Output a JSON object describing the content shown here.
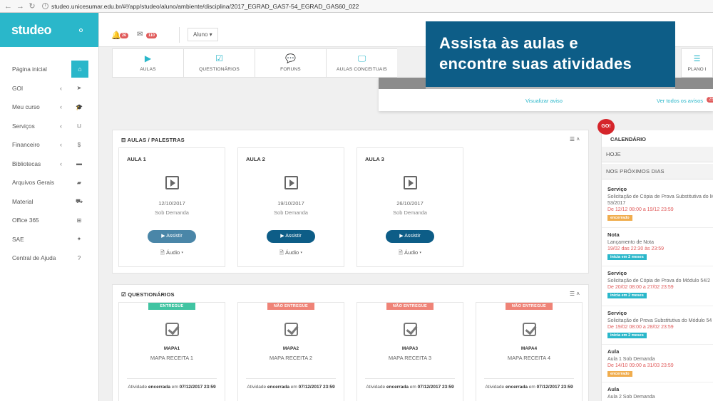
{
  "browser": {
    "url": "studeo.unicesumar.edu.br/#!/app/studeo/aluno/ambiente/disciplina/2017_EGRAD_GAS7-54_EGRAD_GAS60_022"
  },
  "sidebar": {
    "logo": "studeo",
    "items": [
      {
        "label": "Página inicial",
        "icon": "home-icon",
        "glyph": "⌂",
        "chevron": ""
      },
      {
        "label": "GOI",
        "icon": "send-icon",
        "glyph": "➤",
        "chevron": "‹"
      },
      {
        "label": "Meu curso",
        "icon": "graduation-cap-icon",
        "glyph": "🎓",
        "chevron": "‹"
      },
      {
        "label": "Serviços",
        "icon": "basket-icon",
        "glyph": "⊔",
        "chevron": "‹"
      },
      {
        "label": "Financeiro",
        "icon": "dollar-icon",
        "glyph": "$",
        "chevron": "‹"
      },
      {
        "label": "Bibliotecas",
        "icon": "book-icon",
        "glyph": "▬",
        "chevron": "‹"
      },
      {
        "label": "Arquivos Gerais",
        "icon": "folder-icon",
        "glyph": "▰",
        "chevron": ""
      },
      {
        "label": "Material",
        "icon": "truck-icon",
        "glyph": "⛟",
        "chevron": ""
      },
      {
        "label": "Office 365",
        "icon": "windows-icon",
        "glyph": "⊞",
        "chevron": ""
      },
      {
        "label": "SAE",
        "icon": "puzzle-icon",
        "glyph": "✦",
        "chevron": ""
      },
      {
        "label": "Central de Ajuda",
        "icon": "question-icon",
        "glyph": "?",
        "chevron": ""
      }
    ]
  },
  "header": {
    "notifications_count": "26",
    "messages_count": "110",
    "profile_select": "Aluno ▾"
  },
  "tabs": [
    {
      "label": "AULAS",
      "glyph": "▶",
      "icon": "play-square-icon"
    },
    {
      "label": "QUESTIONÁRIOS",
      "glyph": "☑",
      "icon": "checkbox-icon"
    },
    {
      "label": "FORUNS",
      "glyph": "💬",
      "icon": "comments-icon"
    },
    {
      "label": "AULAS CONCEITUAIS",
      "glyph": "🖵",
      "icon": "monitor-icon"
    }
  ],
  "tab_plano": {
    "label": "PLANO I",
    "glyph": "☰",
    "icon": "list-icon"
  },
  "overlay": {
    "line1": "Assista às aulas e",
    "line2": "encontre suas atividades"
  },
  "notice": {
    "view_link": "Visualizar aviso",
    "all_link": "Ver todos os avisos",
    "count": "25"
  },
  "aulas": {
    "title": "AULAS / PALESTRAS",
    "control": "☰ ˄",
    "cards": [
      {
        "title": "AULA 1",
        "date": "12/10/2017",
        "mode": "Sob Demanda",
        "button": "▶  Assistir",
        "audio": "🗎 Áudio ▾"
      },
      {
        "title": "AULA 2",
        "date": "19/10/2017",
        "mode": "Sob Demanda",
        "button": "▶  Assistir",
        "audio": "🗎 Áudio ▾"
      },
      {
        "title": "AULA 3",
        "date": "26/10/2017",
        "mode": "Sob Demanda",
        "button": "▶  Assistir",
        "audio": "🗎 Áudio ▾"
      }
    ]
  },
  "questionarios": {
    "title": "QUESTIONÁRIOS",
    "control": "☰ ˄",
    "cards": [
      {
        "status": "ENTREGUE",
        "code": "MAPA1",
        "name": "MAPA RECEITA 1",
        "footer_pre": "Atividade ",
        "footer_bold": "encerrada",
        "footer_mid": " em ",
        "footer_date": "07/12/2017 23:59"
      },
      {
        "status": "NÃO ENTREGUE",
        "code": "MAPA2",
        "name": "MAPA RECEITA 2",
        "footer_pre": "Atividade ",
        "footer_bold": "encerrada",
        "footer_mid": " em ",
        "footer_date": "07/12/2017 23:59"
      },
      {
        "status": "NÃO ENTREGUE",
        "code": "MAPA3",
        "name": "MAPA RECEITA 3",
        "footer_pre": "Atividade ",
        "footer_bold": "encerrada",
        "footer_mid": " em ",
        "footer_date": "07/12/2017 23:59"
      },
      {
        "status": "NÃO ENTREGUE",
        "code": "MAPA4",
        "name": "MAPA RECEITA 4",
        "footer_pre": "Atividade ",
        "footer_bold": "encerrada",
        "footer_mid": " em ",
        "footer_date": "07/12/2017 23:59"
      }
    ]
  },
  "calendar": {
    "logo": "GO!",
    "title": "CALENDÁRIO",
    "today": "HOJE",
    "next_days": "NOS PRÓXIMOS DIAS",
    "events": [
      {
        "type": "Serviço",
        "desc1": "Solicitação de Cópia de Prova Substitutiva do M",
        "desc2": "53/2017",
        "date": "De 12/12 08:00 a 19/12 23:59",
        "tag": "encerrado",
        "tag_style": "y"
      },
      {
        "type": "Nota",
        "desc1": "Lançamento de Nota",
        "desc2": "",
        "date": "19/02 das 22:30 às 23:59",
        "tag": "inicia em 2 meses",
        "tag_style": "t"
      },
      {
        "type": "Serviço",
        "desc1": "Solicitação de Cópia de Prova do Módulo 54/2",
        "desc2": "",
        "date": "De 20/02 08:00 a 27/02 23:59",
        "tag": "inicia em 2 meses",
        "tag_style": "t"
      },
      {
        "type": "Serviço",
        "desc1": "Solicitação de Prova Substitutiva do Módulo 54",
        "desc2": "",
        "date": "De 19/02 08:00 a 28/02 23:59",
        "tag": "inicia em 2 meses",
        "tag_style": "t"
      },
      {
        "type": "Aula",
        "desc1": "Aula 1 Sob Demanda",
        "desc2": "",
        "date": "De 14/10 09:00 a 31/03 23:59",
        "tag": "encerrado",
        "tag_style": "y"
      },
      {
        "type": "Aula",
        "desc1": "Aula 2 Sob Demanda",
        "desc2": "",
        "date": "",
        "tag": "",
        "tag_style": "t"
      }
    ]
  }
}
